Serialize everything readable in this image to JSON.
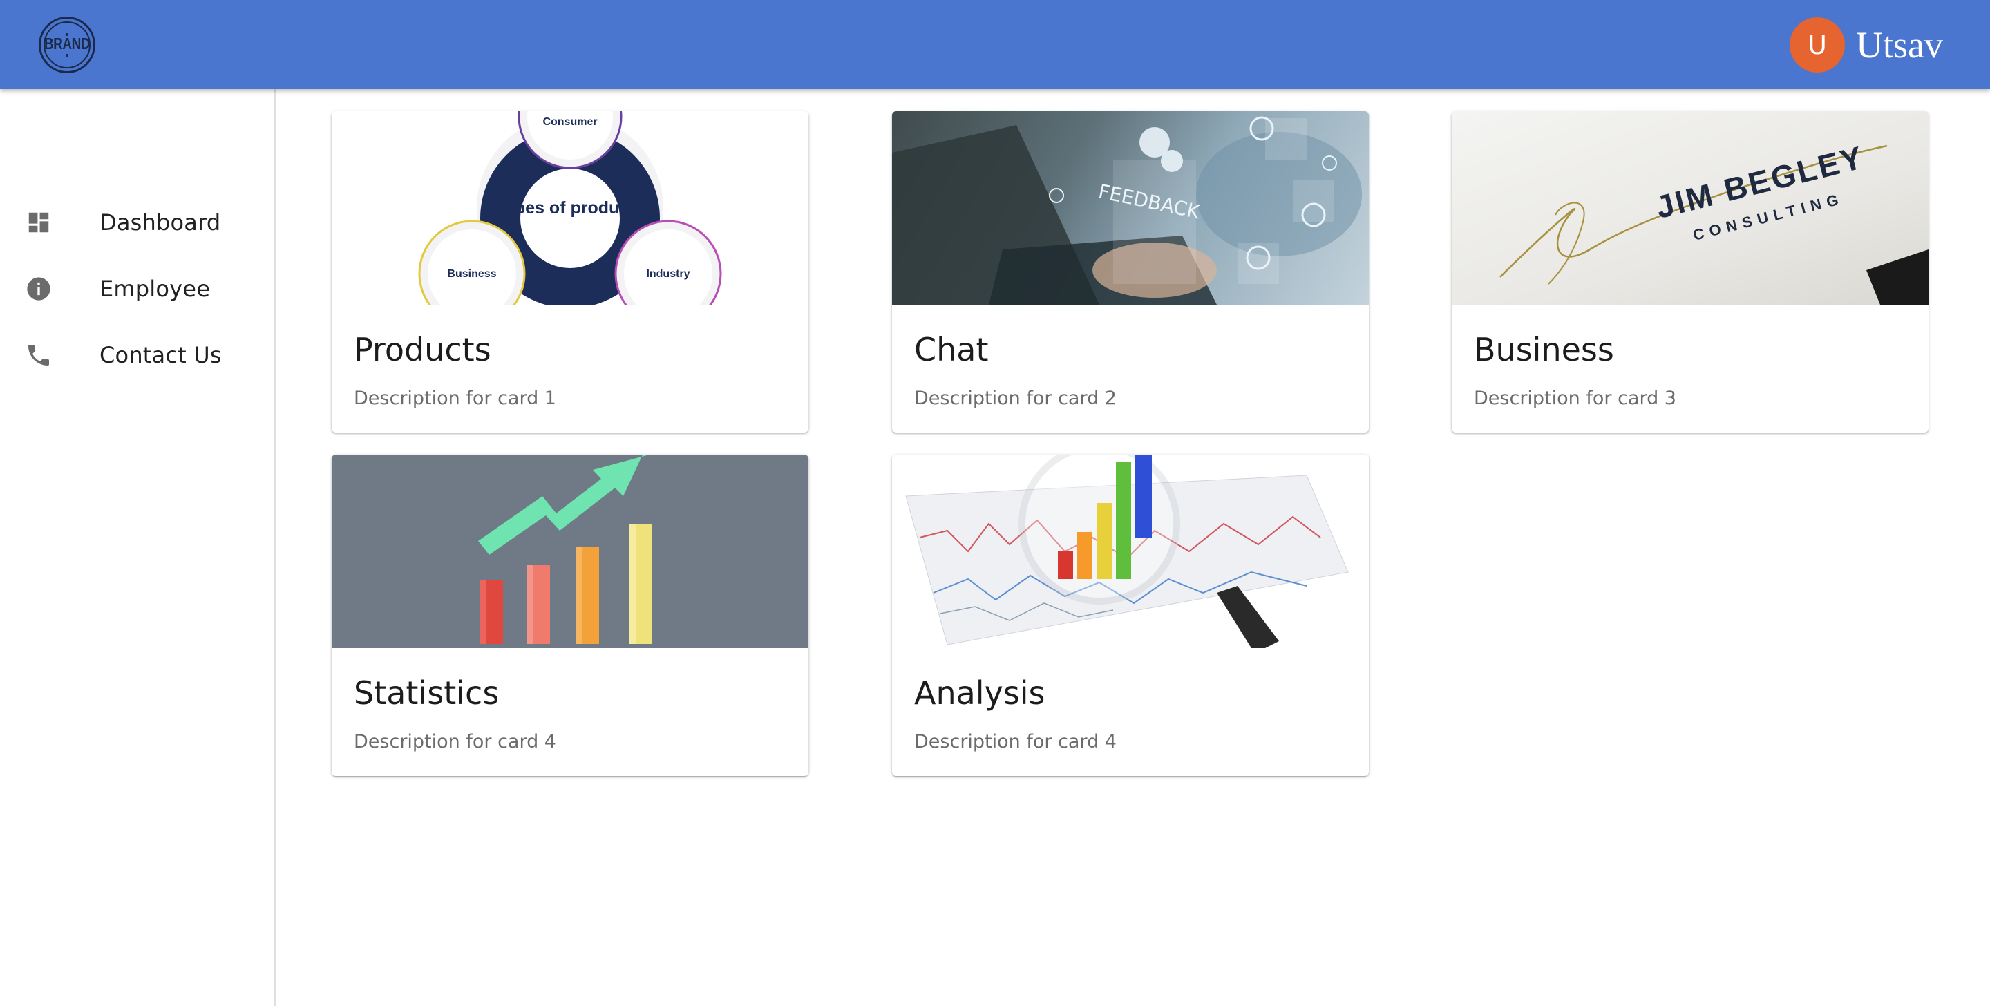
{
  "header": {
    "brand_logo_text": "BRAND",
    "user": {
      "initial": "U",
      "name": "Utsav"
    },
    "color": "#4a76cf",
    "avatar_color": "#e5642f"
  },
  "sidebar": {
    "items": [
      {
        "label": "Dashboard",
        "icon": "dashboard-icon"
      },
      {
        "label": "Employee",
        "icon": "info-icon"
      },
      {
        "label": "Contact Us",
        "icon": "phone-icon"
      }
    ]
  },
  "cards": [
    {
      "title": "Products",
      "description": "Description for card 1",
      "image": "types-of-products-diagram",
      "image_text": {
        "center": "Types of products",
        "top": "Consumer",
        "left": "Business",
        "right": "Industry"
      }
    },
    {
      "title": "Chat",
      "description": "Description for card 2",
      "image": "feedback-laptop-photo",
      "image_text": {
        "overlay": "FEEDBACK"
      }
    },
    {
      "title": "Business",
      "description": "Description for card 3",
      "image": "business-card-photo",
      "image_text": {
        "name": "JIM BEGLEY",
        "sub": "CONSULTING"
      }
    },
    {
      "title": "Statistics",
      "description": "Description for card 4",
      "image": "growth-bars-arrow-photo"
    },
    {
      "title": "Analysis",
      "description": "Description for card 4",
      "image": "magnifier-chart-photo"
    }
  ]
}
